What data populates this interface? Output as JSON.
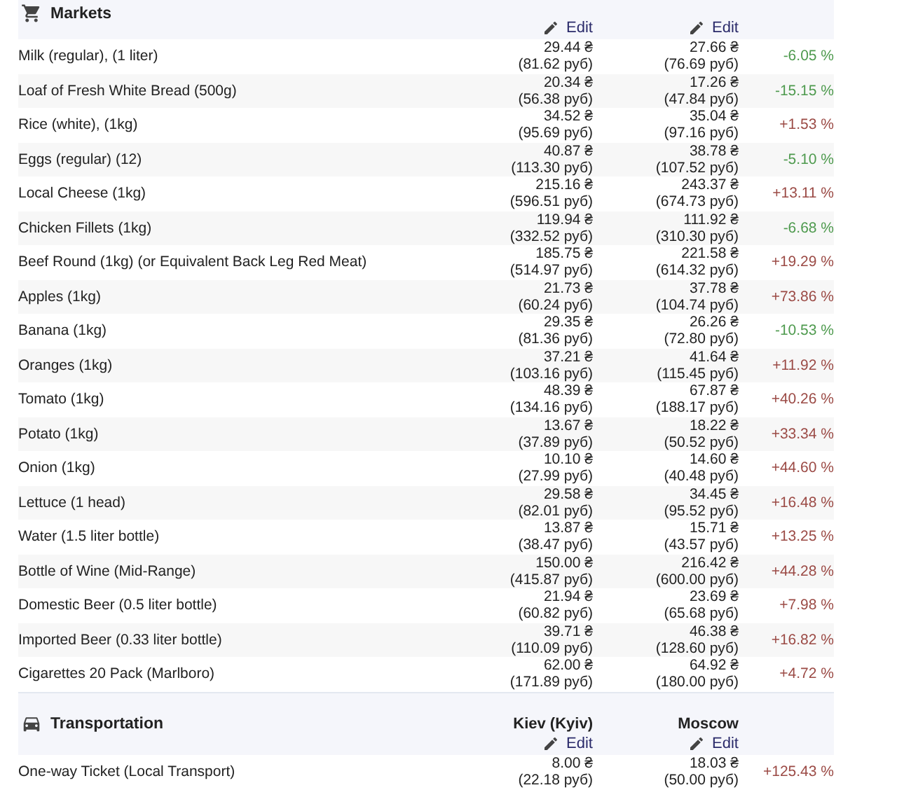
{
  "sections": [
    {
      "title": "Markets",
      "kind": "cart",
      "edit_links": [
        "Edit",
        "Edit"
      ],
      "rows": [
        {
          "item": "Milk (regular), (1 liter)",
          "city_1": "29.44 ₴",
          "city_1_rub": "(81.62 руб)",
          "city_2": "27.66 ₴",
          "city_2_rub": "(76.69 руб)",
          "change": "-6.05 %",
          "color": "#4e9a4e"
        },
        {
          "item": "Loaf of Fresh White Bread (500g)",
          "city_1": "20.34 ₴",
          "city_1_rub": "(56.38 руб)",
          "city_2": "17.26 ₴",
          "city_2_rub": "(47.84 руб)",
          "change": "-15.15 %",
          "color": "#4e9a4e"
        },
        {
          "item": "Rice (white), (1kg)",
          "city_1": "34.52 ₴",
          "city_1_rub": "(95.69 руб)",
          "city_2": "35.04 ₴",
          "city_2_rub": "(97.16 руб)",
          "change": "+1.53 %",
          "color": "#9b4a45"
        },
        {
          "item": "Eggs (regular) (12)",
          "city_1": "40.87 ₴",
          "city_1_rub": "(113.30 руб)",
          "city_2": "38.78 ₴",
          "city_2_rub": "(107.52 руб)",
          "change": "-5.10 %",
          "color": "#4e9a4e"
        },
        {
          "item": "Local Cheese (1kg)",
          "city_1": "215.16 ₴",
          "city_1_rub": "(596.51 руб)",
          "city_2": "243.37 ₴",
          "city_2_rub": "(674.73 руб)",
          "change": "+13.11 %",
          "color": "#9b4a45"
        },
        {
          "item": "Chicken Fillets (1kg)",
          "city_1": "119.94 ₴",
          "city_1_rub": "(332.52 руб)",
          "city_2": "111.92 ₴",
          "city_2_rub": "(310.30 руб)",
          "change": "-6.68 %",
          "color": "#4e9a4e"
        },
        {
          "item": "Beef Round (1kg) (or Equivalent Back Leg Red Meat)",
          "city_1": "185.75 ₴",
          "city_1_rub": "(514.97 руб)",
          "city_2": "221.58 ₴",
          "city_2_rub": "(614.32 руб)",
          "change": "+19.29 %",
          "color": "#9b4a45"
        },
        {
          "item": "Apples (1kg)",
          "city_1": "21.73 ₴",
          "city_1_rub": "(60.24 руб)",
          "city_2": "37.78 ₴",
          "city_2_rub": "(104.74 руб)",
          "change": "+73.86 %",
          "color": "#9b4a45"
        },
        {
          "item": "Banana (1kg)",
          "city_1": "29.35 ₴",
          "city_1_rub": "(81.36 руб)",
          "city_2": "26.26 ₴",
          "city_2_rub": "(72.80 руб)",
          "change": "-10.53 %",
          "color": "#4e9a4e"
        },
        {
          "item": "Oranges (1kg)",
          "city_1": "37.21 ₴",
          "city_1_rub": "(103.16 руб)",
          "city_2": "41.64 ₴",
          "city_2_rub": "(115.45 руб)",
          "change": "+11.92 %",
          "color": "#9b4a45"
        },
        {
          "item": "Tomato (1kg)",
          "city_1": "48.39 ₴",
          "city_1_rub": "(134.16 руб)",
          "city_2": "67.87 ₴",
          "city_2_rub": "(188.17 руб)",
          "change": "+40.26 %",
          "color": "#9b4a45"
        },
        {
          "item": "Potato (1kg)",
          "city_1": "13.67 ₴",
          "city_1_rub": "(37.89 руб)",
          "city_2": "18.22 ₴",
          "city_2_rub": "(50.52 руб)",
          "change": "+33.34 %",
          "color": "#9b4a45"
        },
        {
          "item": "Onion (1kg)",
          "city_1": "10.10 ₴",
          "city_1_rub": "(27.99 руб)",
          "city_2": "14.60 ₴",
          "city_2_rub": "(40.48 руб)",
          "change": "+44.60 %",
          "color": "#9b4a45"
        },
        {
          "item": "Lettuce (1 head)",
          "city_1": "29.58 ₴",
          "city_1_rub": "(82.01 руб)",
          "city_2": "34.45 ₴",
          "city_2_rub": "(95.52 руб)",
          "change": "+16.48 %",
          "color": "#9b4a45"
        },
        {
          "item": "Water (1.5 liter bottle)",
          "city_1": "13.87 ₴",
          "city_1_rub": "(38.47 руб)",
          "city_2": "15.71 ₴",
          "city_2_rub": "(43.57 руб)",
          "change": "+13.25 %",
          "color": "#9b4a45"
        },
        {
          "item": "Bottle of Wine (Mid-Range)",
          "city_1": "150.00 ₴",
          "city_1_rub": "(415.87 руб)",
          "city_2": "216.42 ₴",
          "city_2_rub": "(600.00 руб)",
          "change": "+44.28 %",
          "color": "#9b4a45"
        },
        {
          "item": "Domestic Beer (0.5 liter bottle)",
          "city_1": "21.94 ₴",
          "city_1_rub": "(60.82 руб)",
          "city_2": "23.69 ₴",
          "city_2_rub": "(65.68 руб)",
          "change": "+7.98 %",
          "color": "#9b4a45"
        },
        {
          "item": "Imported Beer (0.33 liter bottle)",
          "city_1": "39.71 ₴",
          "city_1_rub": "(110.09 руб)",
          "city_2": "46.38 ₴",
          "city_2_rub": "(128.60 руб)",
          "change": "+16.82 %",
          "color": "#9b4a45"
        },
        {
          "item": "Cigarettes 20 Pack (Marlboro)",
          "city_1": "62.00 ₴",
          "city_1_rub": "(171.89 руб)",
          "city_2": "64.92 ₴",
          "city_2_rub": "(180.00 руб)",
          "change": "+4.72 %",
          "color": "#9b4a45"
        }
      ]
    },
    {
      "title": "Transportation",
      "kind": "car",
      "cities": [
        "Kiev (Kyiv)",
        "Moscow"
      ],
      "edit_links": [
        "Edit",
        "Edit"
      ],
      "rows": [
        {
          "item": "One-way Ticket (Local Transport)",
          "city_1": "8.00 ₴",
          "city_1_rub": "(22.18 руб)",
          "city_2": "18.03 ₴",
          "city_2_rub": "(50.00 руб)",
          "change": "+125.43 %",
          "color": "#9b4a45"
        }
      ]
    }
  ]
}
